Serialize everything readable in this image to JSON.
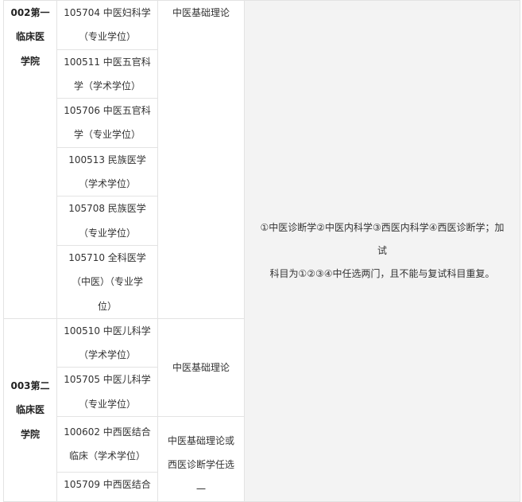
{
  "schools": [
    {
      "line1": "002第一",
      "line2": "临床医",
      "line3": "学院"
    },
    {
      "line1": "003第二",
      "line2": "临床医",
      "line3": "学院"
    }
  ],
  "majors": [
    {
      "line1": "105704 中医妇科学",
      "line2": "（专业学位）"
    },
    {
      "line1": "100511 中医五官科",
      "line2": "学（学术学位）"
    },
    {
      "line1": "105706 中医五官科",
      "line2": "学（专业学位）"
    },
    {
      "line1": "100513 民族医学",
      "line2": "（学术学位）"
    },
    {
      "line1": "105708 民族医学",
      "line2": "（专业学位）"
    },
    {
      "line1": "105710 全科医学",
      "line2": "（中医）（专业学",
      "line3": "位）"
    },
    {
      "line1": "100510 中医儿科学",
      "line2": "（学术学位）"
    },
    {
      "line1": "105705 中医儿科学",
      "line2": "（专业学位）"
    },
    {
      "line1": "100602 中西医结合",
      "line2": "临床（学术学位）"
    },
    {
      "line1": "105709 中西医结合"
    }
  ],
  "subjects": {
    "s1": "中医基础理论",
    "s2": "中医基础理论",
    "s3_line1": "中医基础理论或",
    "s3_line2": "西医诊断学任选",
    "s3_line3": "一"
  },
  "extra_exam": {
    "line1": "①中医诊断学②中医内科学③西医内科学④西医诊断学；加试",
    "line2": "科目为①②③④中任选两门，且不能与复试科目重复。"
  }
}
